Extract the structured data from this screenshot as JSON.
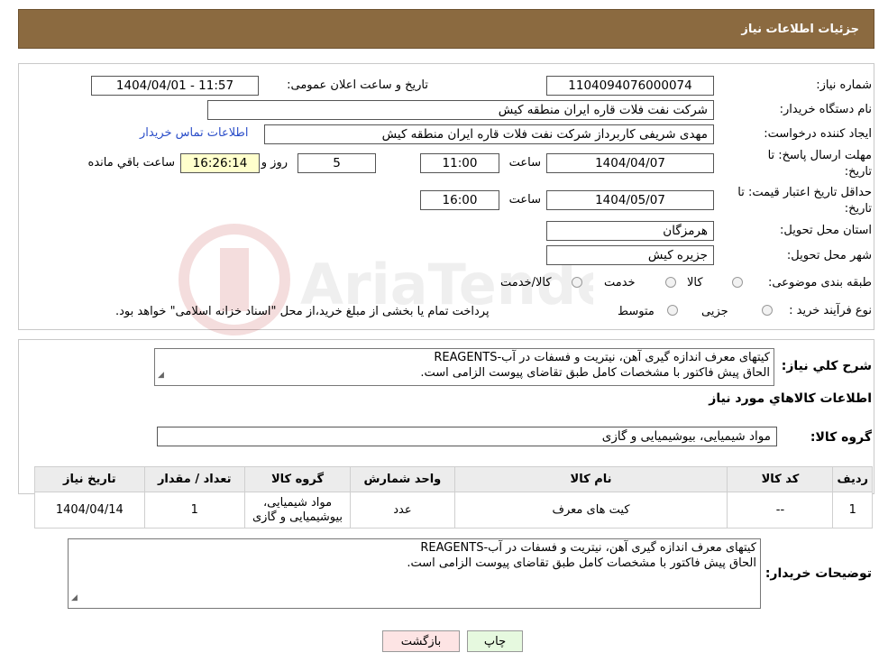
{
  "header": {
    "title": "جزئیات اطلاعات نیاز"
  },
  "form": {
    "need_number_label": "شماره نیاز:",
    "need_number": "1104094076000074",
    "announce_label": "تاریخ و ساعت اعلان عمومی:",
    "announce_value": "1404/04/01 - 11:57",
    "buyer_org_label": "نام دستگاه خریدار:",
    "buyer_org": "شرکت نفت فلات قاره ایران منطقه کیش",
    "creator_label": "ایجاد کننده درخواست:",
    "creator": "مهدی شریفی کاربرداز شرکت نفت فلات قاره ایران منطقه کیش",
    "contact_link": "اطلاعات تماس خریدار",
    "deadline_label_1": "مهلت ارسال پاسخ: تا",
    "deadline_label_2": "تاریخ:",
    "deadline_date": "1404/04/07",
    "time_label": "ساعت",
    "deadline_time": "11:00",
    "days_value": "5",
    "days_label": "روز و",
    "remaining_time": "16:26:14",
    "remaining_label": "ساعت باقي مانده",
    "validity_label_1": "حداقل تاریخ اعتبار قیمت: تا",
    "validity_label_2": "تاریخ:",
    "validity_date": "1404/05/07",
    "validity_time": "16:00",
    "province_label": "استان محل تحویل:",
    "province": "هرمزگان",
    "city_label": "شهر محل تحویل:",
    "city": "جزیره کیش",
    "category_label": "طبقه بندی موضوعی:",
    "category_options": [
      "کالا",
      "خدمت",
      "کالا/خدمت"
    ],
    "process_label": "نوع فرآیند خرید :",
    "process_options": [
      "جزیی",
      "متوسط"
    ],
    "process_note": "پرداخت تمام یا بخشی از مبلغ خرید،از محل \"اسناد خزانه اسلامی\" خواهد بود."
  },
  "summary": {
    "label": "شرح کلي نیاز:",
    "line1": "کیتهای معرف اندازه گیری آهن، نیتریت و فسفات در آب-REAGENTS",
    "line2": "الحاق پیش فاکتور با مشخصات کامل طبق تقاضای پیوست الزامی است.",
    "goods_info_title": "اطلاعات کالاهاي مورد نیاز",
    "goods_group_label": "گروه کالا:",
    "goods_group": "مواد شیمیایی، بیوشیمیایی و  گازی"
  },
  "table": {
    "headers": [
      "ردیف",
      "کد کالا",
      "نام کالا",
      "واحد شمارش",
      "گروه کالا",
      "تعداد / مقدار",
      "تاریخ نیاز"
    ],
    "rows": [
      {
        "row": "1",
        "code": "--",
        "name": "کیت های معرف",
        "unit": "عدد",
        "group": "مواد شیمیایی، بیوشیمیایی و گازی",
        "qty": "1",
        "date": "1404/04/14"
      }
    ]
  },
  "buyer_notes": {
    "label": "توضیحات خریدار:",
    "line1": "کیتهای معرف اندازه گیری آهن، نیتریت و فسفات در آب-REAGENTS",
    "line2": "الحاق پیش فاکتور با مشخصات کامل طبق تقاضای پیوست الزامی است."
  },
  "buttons": {
    "print": "چاپ",
    "back": "بازگشت"
  },
  "watermark": {
    "text": "AriaTender.net"
  },
  "colors": {
    "header_bg": "#8b6a40",
    "link": "#2b4ec9",
    "highlight": "#ffffcc",
    "print_btn": "#e6f9df",
    "back_btn": "#fde4e4"
  }
}
